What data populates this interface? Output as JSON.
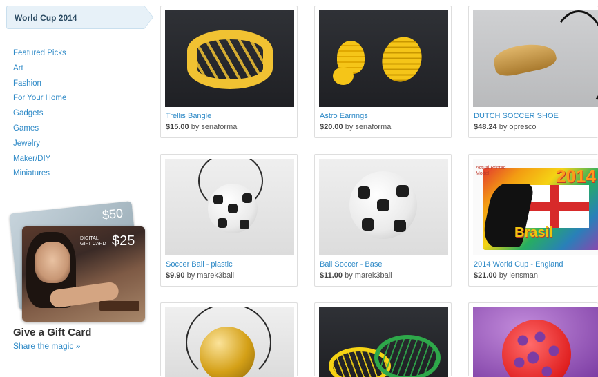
{
  "sidebar": {
    "active_category": "World Cup 2014",
    "categories": [
      "Featured Picks",
      "Art",
      "Fashion",
      "For Your Home",
      "Gadgets",
      "Games",
      "Jewelry",
      "Maker/DIY",
      "Miniatures"
    ],
    "gift_card": {
      "back_amount": "$50",
      "front_label": "DIGITAL GIFT CARD",
      "front_amount": "$25",
      "title": "Give a Gift Card",
      "link": "Share the magic »"
    }
  },
  "products": [
    {
      "name": "Trellis Bangle",
      "price": "$15.00",
      "by": "by",
      "seller": "seriaforma"
    },
    {
      "name": "Astro Earrings",
      "price": "$20.00",
      "by": "by",
      "seller": "seriaforma"
    },
    {
      "name": "DUTCH SOCCER SHOE",
      "price": "$48.24",
      "by": "by",
      "seller": "opresco"
    },
    {
      "name": "Soccer Ball - plastic",
      "price": "$9.90",
      "by": "by",
      "seller": "marek3ball"
    },
    {
      "name": "Ball Soccer - Base",
      "price": "$11.00",
      "by": "by",
      "seller": "marek3ball"
    },
    {
      "name": "2014 World Cup - England",
      "price": "$21.00",
      "by": "by",
      "seller": "lensman"
    }
  ],
  "image_text": {
    "worldcup_label": "Actual Printed Model",
    "worldcup_year": "2014",
    "worldcup_bottom": "Brasil"
  },
  "colors": {
    "link": "#2f8ac7",
    "active_tab_bg": "#e7f1f8"
  }
}
